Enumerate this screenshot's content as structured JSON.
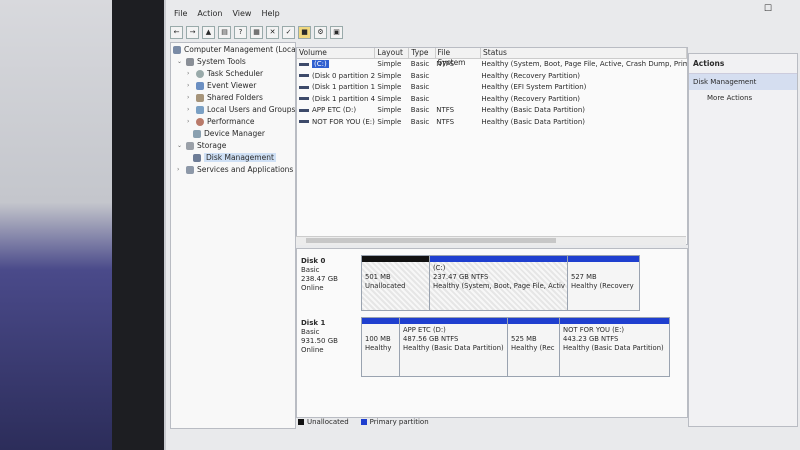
{
  "menu": [
    "File",
    "Action",
    "View",
    "Help"
  ],
  "toolbar": [
    "back",
    "forward",
    "up",
    "show-hide",
    "help",
    "properties",
    "delete",
    "check",
    "folder",
    "settings",
    "more"
  ],
  "window_controls": {
    "restore": "☐"
  },
  "tree": {
    "root": "Computer Management (Local",
    "items": [
      {
        "label": "System Tools"
      },
      {
        "label": "Task Scheduler"
      },
      {
        "label": "Event Viewer"
      },
      {
        "label": "Shared Folders"
      },
      {
        "label": "Local Users and Groups"
      },
      {
        "label": "Performance"
      },
      {
        "label": "Device Manager"
      },
      {
        "label": "Storage"
      },
      {
        "label": "Disk Management"
      },
      {
        "label": "Services and Applications"
      }
    ]
  },
  "volume_table": {
    "headers": [
      "Volume",
      "Layout",
      "Type",
      "File System",
      "Status"
    ],
    "rows": [
      [
        "(C:)",
        "Simple",
        "Basic",
        "NTFS",
        "Healthy (System, Boot, Page File, Active, Crash Dump, Prim"
      ],
      [
        "(Disk 0 partition 2)",
        "Simple",
        "Basic",
        "",
        "Healthy (Recovery Partition)"
      ],
      [
        "(Disk 1 partition 1)",
        "Simple",
        "Basic",
        "",
        "Healthy (EFI System Partition)"
      ],
      [
        "(Disk 1 partition 4)",
        "Simple",
        "Basic",
        "",
        "Healthy (Recovery Partition)"
      ],
      [
        "APP ETC (D:)",
        "Simple",
        "Basic",
        "NTFS",
        "Healthy (Basic Data Partition)"
      ],
      [
        "NOT FOR YOU (E:)",
        "Simple",
        "Basic",
        "NTFS",
        "Healthy (Basic Data Partition)"
      ]
    ]
  },
  "disks": [
    {
      "name": "Disk 0",
      "type": "Basic",
      "size": "238.47 GB",
      "state": "Online",
      "partitions": [
        {
          "title": "",
          "size": "501 MB",
          "status": "Unallocated",
          "cap": "black"
        },
        {
          "title": "(C:)",
          "size": "237.47 GB NTFS",
          "status": "Healthy (System, Boot, Page File, Activ",
          "cap": "blue"
        },
        {
          "title": "",
          "size": "527 MB",
          "status": "Healthy (Recovery",
          "cap": "blue"
        }
      ]
    },
    {
      "name": "Disk 1",
      "type": "Basic",
      "size": "931.50 GB",
      "state": "Online",
      "partitions": [
        {
          "title": "",
          "size": "100 MB",
          "status": "Healthy",
          "cap": "blue"
        },
        {
          "title": "APP ETC (D:)",
          "size": "487.56 GB NTFS",
          "status": "Healthy (Basic Data Partition)",
          "cap": "blue"
        },
        {
          "title": "",
          "size": "525 MB",
          "status": "Healthy (Rec",
          "cap": "blue"
        },
        {
          "title": "NOT FOR YOU (E:)",
          "size": "443.23 GB NTFS",
          "status": "Healthy (Basic Data Partition)",
          "cap": "blue"
        }
      ]
    }
  ],
  "legend": [
    {
      "label": "Unallocated",
      "color": "#111111"
    },
    {
      "label": "Primary partition",
      "color": "#1f3fcf"
    }
  ],
  "actions": {
    "header": "Actions",
    "selected": "Disk Management",
    "more": "More Actions"
  }
}
